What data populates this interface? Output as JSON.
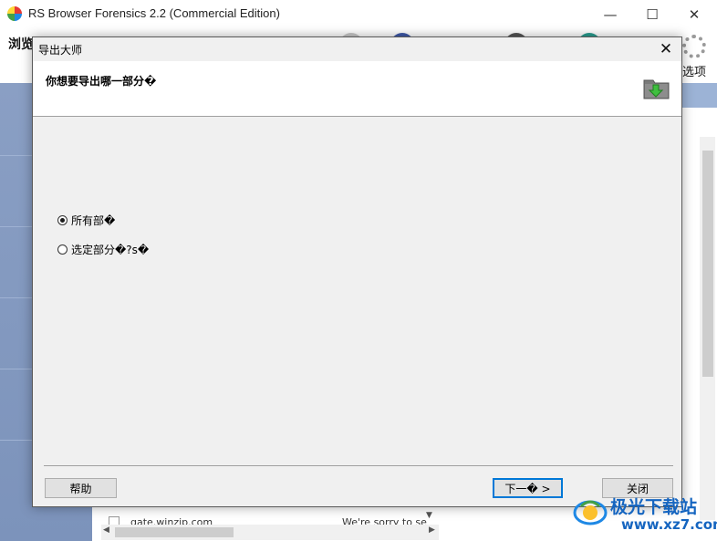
{
  "window": {
    "title": "RS Browser Forensics 2.2 (Commercial Edition)",
    "minimize_glyph": "—",
    "maximize_glyph": "☐",
    "close_glyph": "✕"
  },
  "background": {
    "toolbar_label": "浏览器...",
    "settings_label": "选项",
    "list_row_site": "gate.winzip.com",
    "list_row_snippet": "We're sorry to se"
  },
  "dialog": {
    "title": "导出大师",
    "close_glyph": "✕",
    "question": "你想要导出哪一部分�",
    "options": [
      {
        "label": "所有部�",
        "selected": true
      },
      {
        "label": "选定部分�?s�",
        "selected": false
      }
    ],
    "buttons": {
      "help": "帮助",
      "next": "下一� >",
      "close": "关闭"
    }
  },
  "watermark": {
    "text": "极光下载站",
    "url": "www.xz7.com"
  },
  "colors": {
    "accent": "#0078d7",
    "sidebar": "#8a9fc4",
    "watermark": "#1565c0"
  },
  "icons": {
    "app": "browser-forensics-app-icon",
    "dialog_header": "folder-download-icon",
    "settings": "gear-icon"
  }
}
